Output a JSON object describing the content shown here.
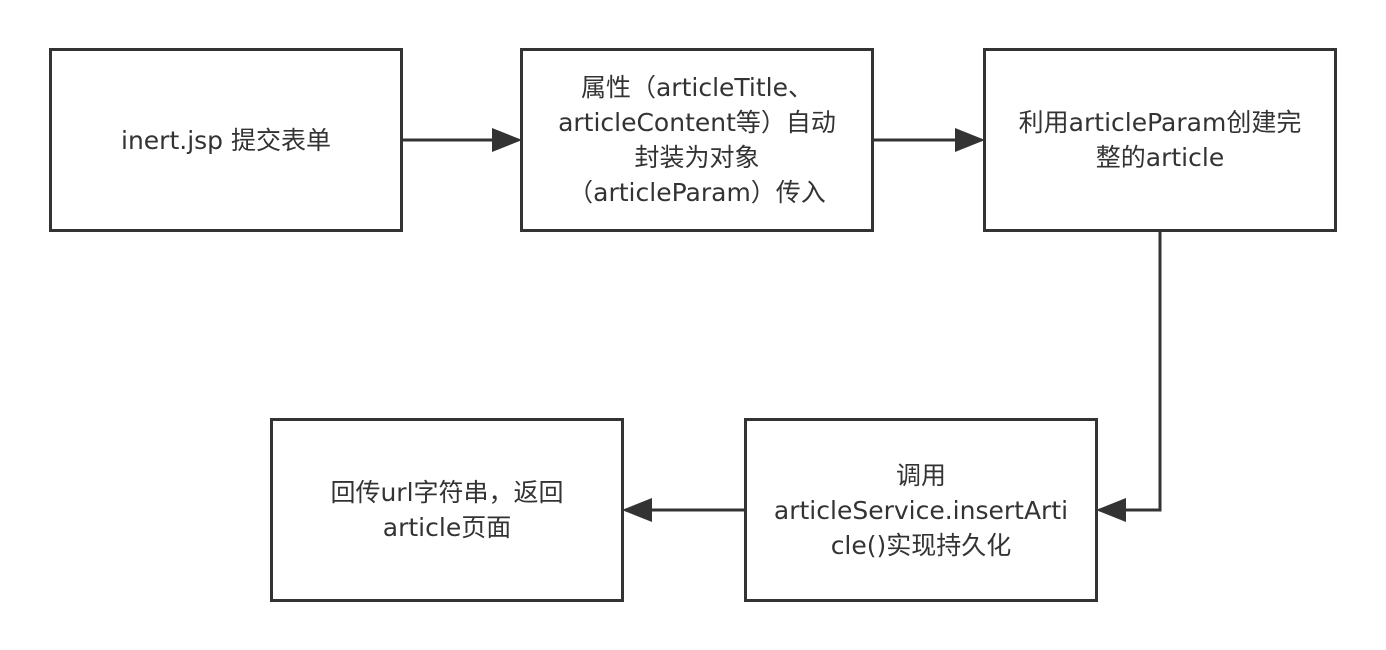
{
  "diagram": {
    "colors": {
      "stroke": "#333333",
      "fill": "#ffffff",
      "text": "#333333"
    },
    "nodes": {
      "submit_form": [
        "inert.jsp 提交表单"
      ],
      "wrap_object": [
        "属性（articleTitle、",
        "articleContent等）自动",
        "封装为对象",
        "（articleParam）传入"
      ],
      "create_article": [
        "利用articleParam创建完",
        "整的article"
      ],
      "persist": [
        "调用",
        "articleService.insertArti",
        "cle()实现持久化"
      ],
      "return_url": [
        "回传url字符串，返回",
        "article页面"
      ]
    }
  }
}
